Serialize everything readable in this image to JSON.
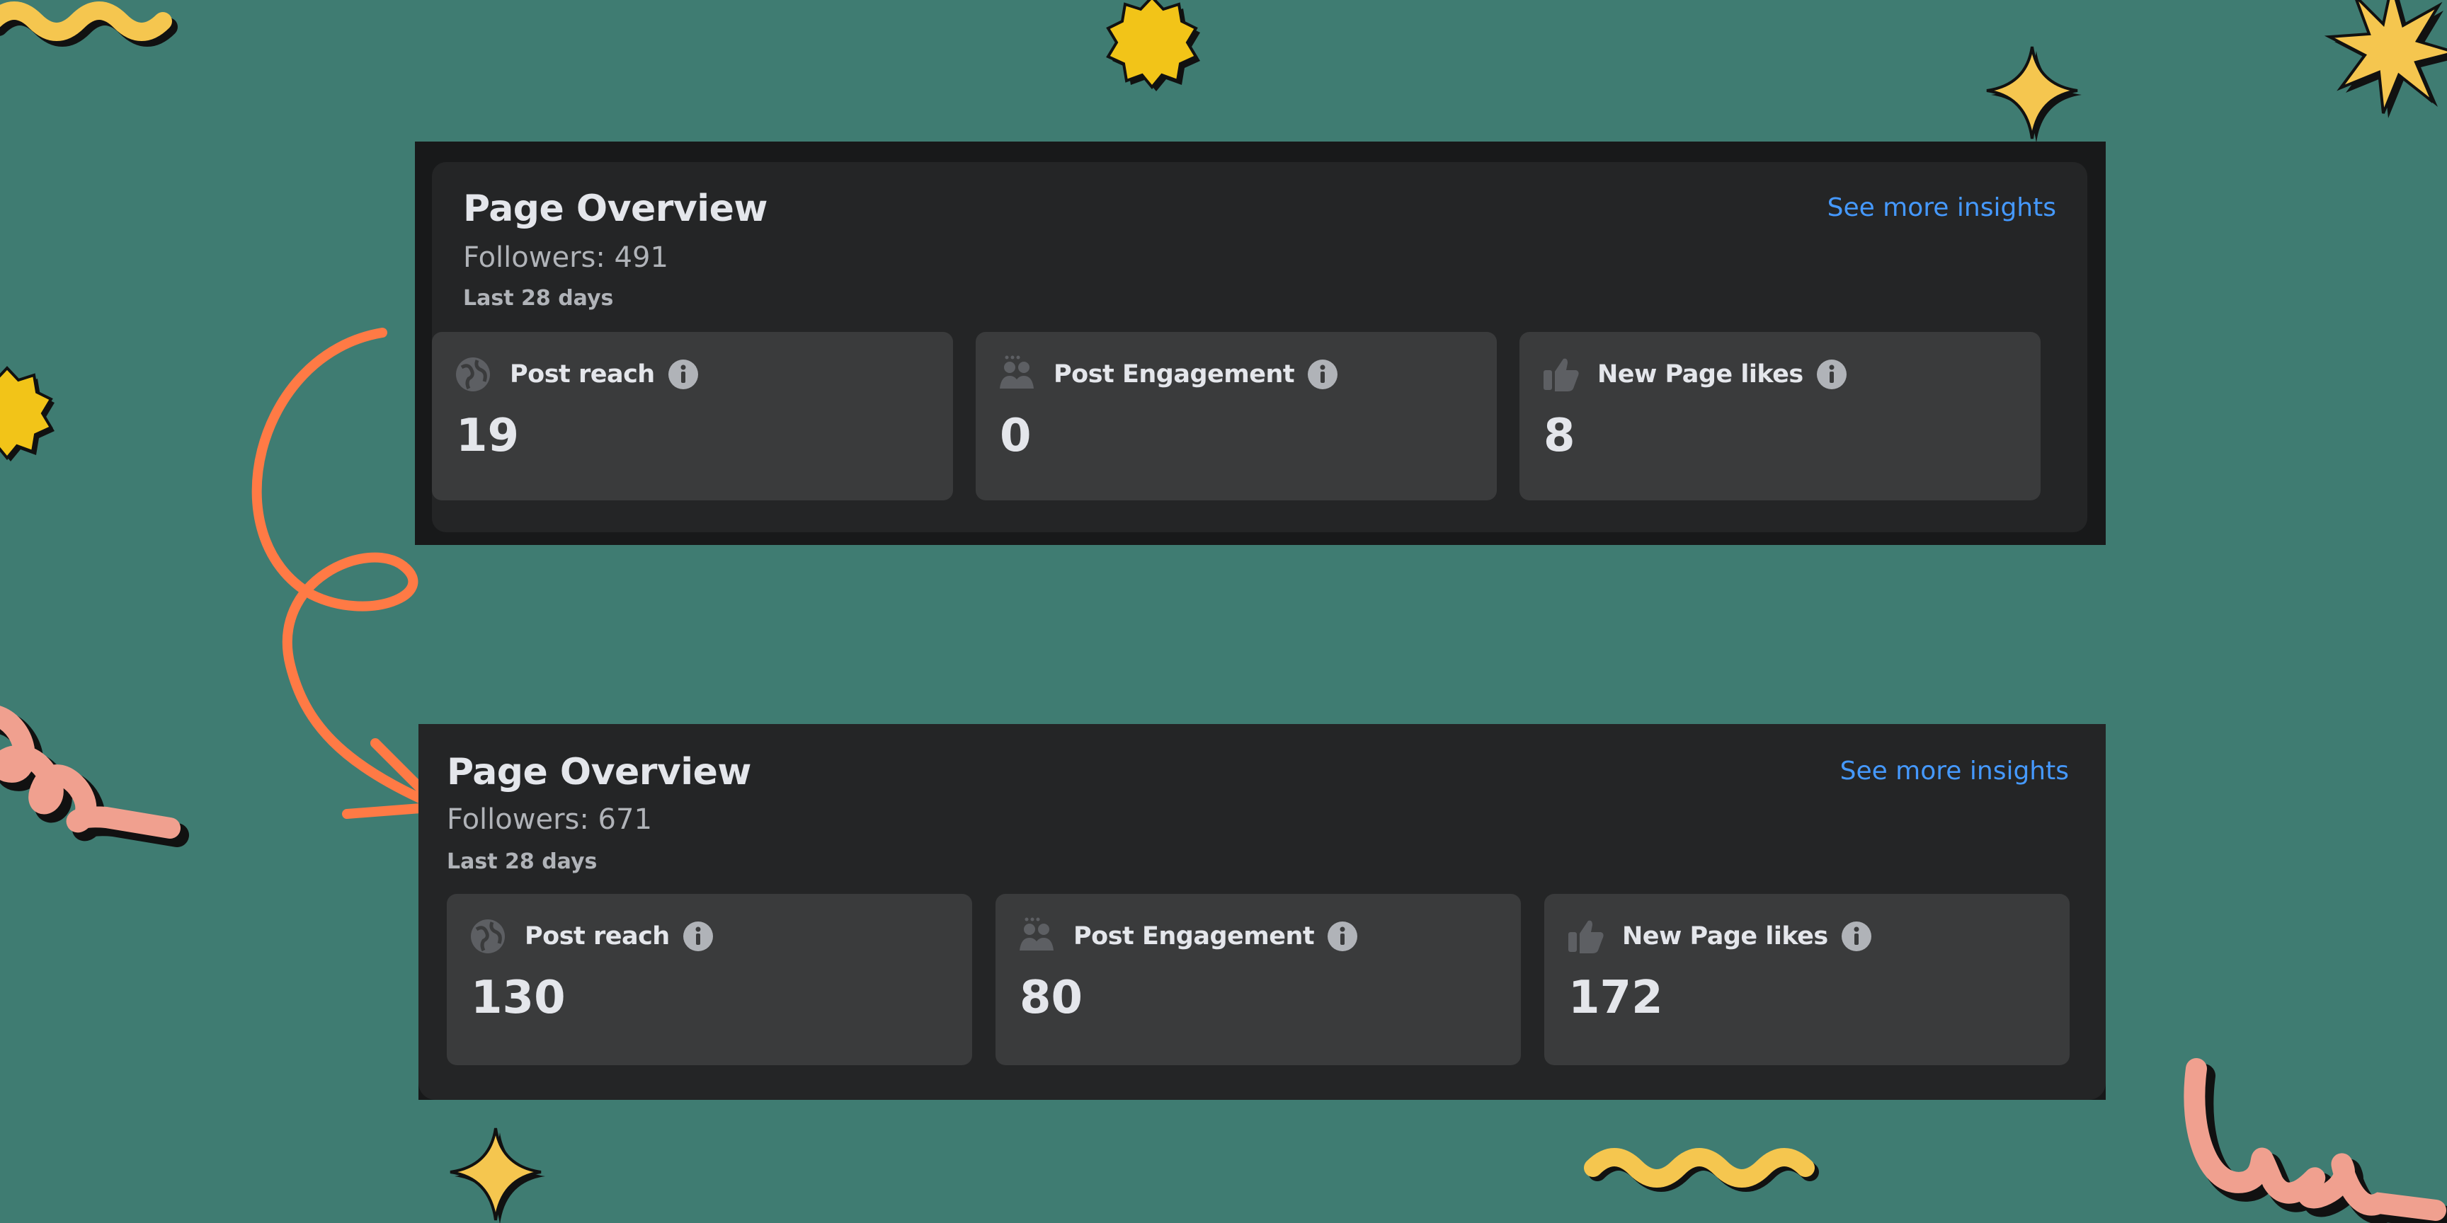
{
  "colors": {
    "background": "#3f7c72",
    "panel": "#18191a",
    "card": "#242526",
    "metric_card": "#3a3b3c",
    "link": "#4599ff",
    "arrow": "#ff7a45",
    "star_yellow": "#f5c64f",
    "squiggle_pink": "#f0a08f"
  },
  "before": {
    "title": "Page Overview",
    "followers": "Followers: 491",
    "range": "Last 28 days",
    "link": "See more insights",
    "metrics": [
      {
        "label": "Post reach",
        "value": "19",
        "icon": "globe-icon"
      },
      {
        "label": "Post Engagement",
        "value": "0",
        "icon": "people-icon"
      },
      {
        "label": "New Page likes",
        "value": "8",
        "icon": "thumbs-up-icon"
      }
    ]
  },
  "after": {
    "title": "Page Overview",
    "followers": "Followers: 671",
    "range": "Last 28 days",
    "link": "See more insights",
    "metrics": [
      {
        "label": "Post reach",
        "value": "130",
        "icon": "globe-icon"
      },
      {
        "label": "Post Engagement",
        "value": "80",
        "icon": "people-icon"
      },
      {
        "label": "New Page likes",
        "value": "172",
        "icon": "thumbs-up-icon"
      }
    ]
  }
}
